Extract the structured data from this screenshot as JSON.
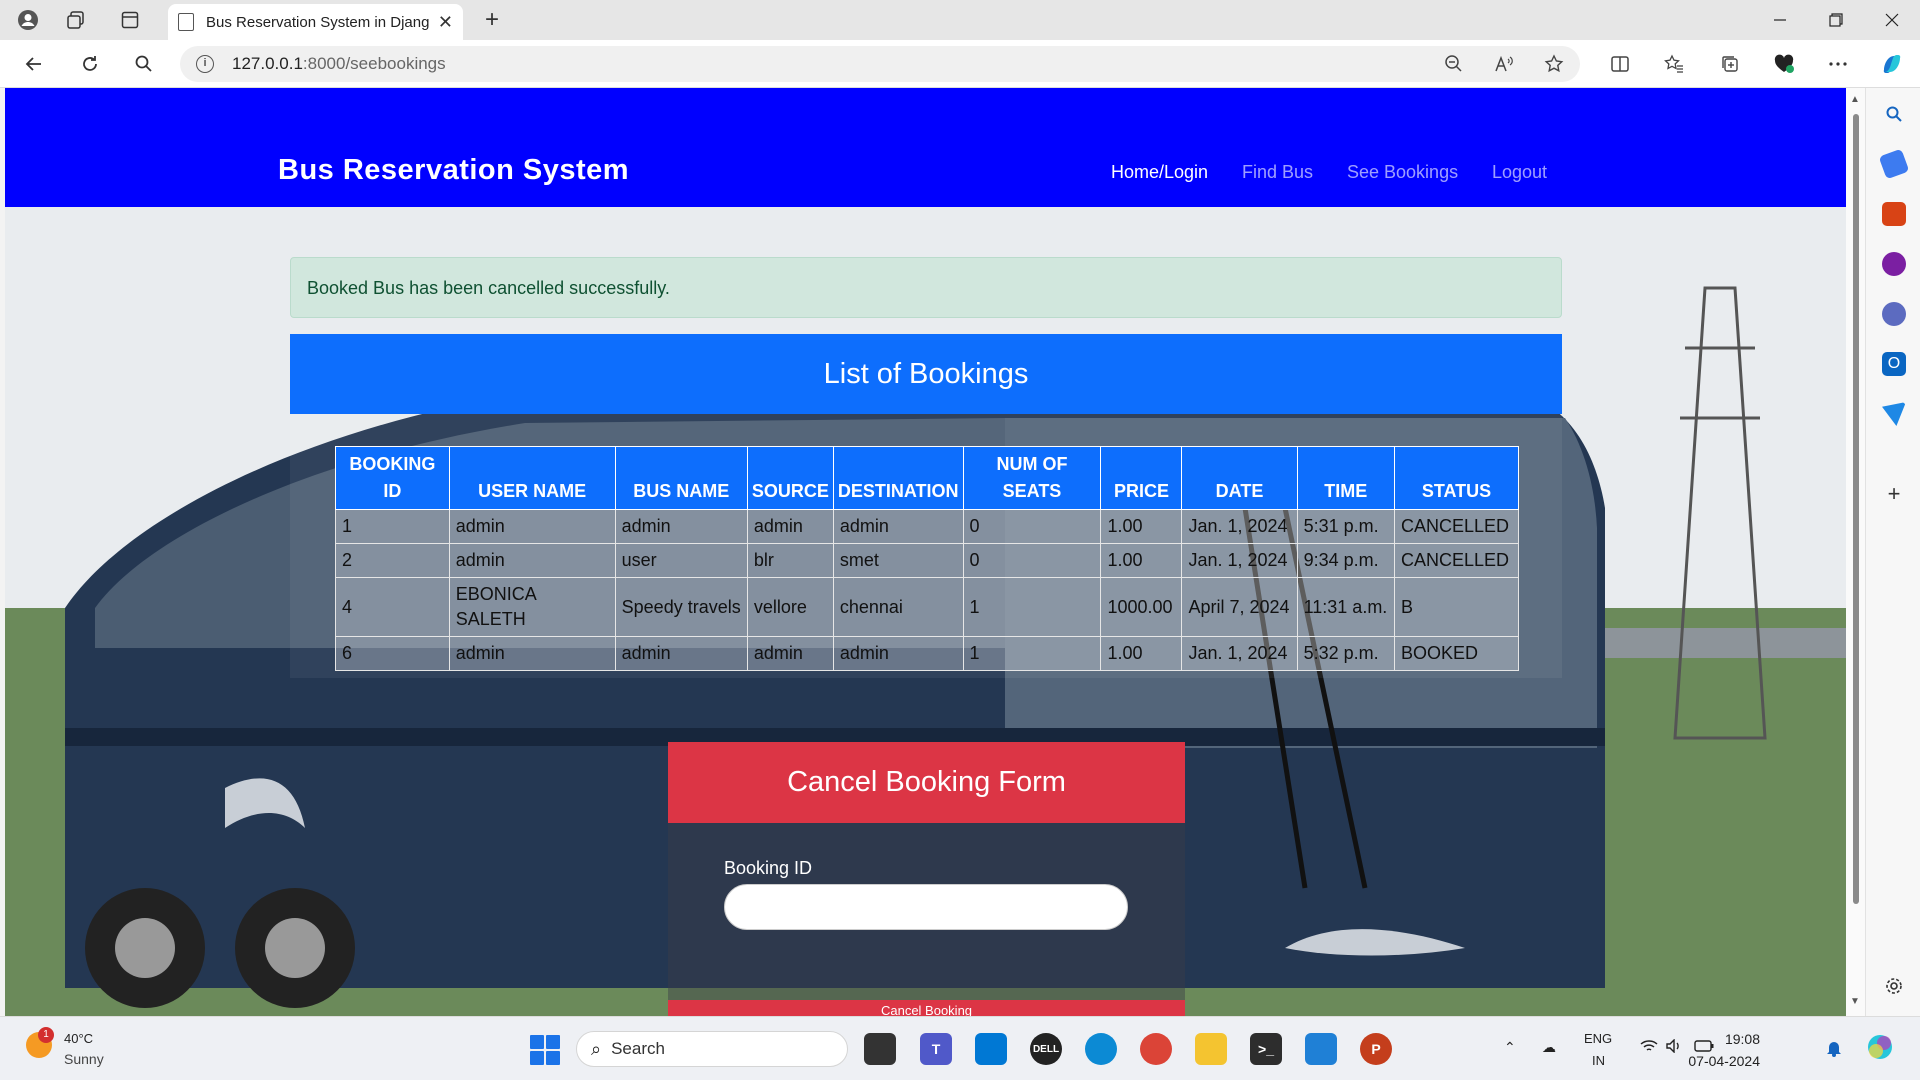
{
  "browser": {
    "tab_title": "Bus Reservation System in Djang",
    "url_host": "127.0.0.1",
    "url_path": ":8000/seebookings",
    "new_tab_glyph": "+",
    "close_glyph": "✕"
  },
  "navbar": {
    "brand": "Bus Reservation System",
    "links": [
      {
        "label": "Home/Login",
        "active": true
      },
      {
        "label": "Find Bus",
        "active": false
      },
      {
        "label": "See Bookings",
        "active": false
      },
      {
        "label": "Logout",
        "active": false
      }
    ],
    "color": "#0000ff"
  },
  "alert": {
    "message": "Booked Bus has been cancelled successfully."
  },
  "bookings": {
    "title": "List of Bookings",
    "headers": [
      "BOOKING ID",
      "USER NAME",
      "BUS NAME",
      "SOURCE",
      "DESTINATION",
      "NUM OF SEATS",
      "PRICE",
      "DATE",
      "TIME",
      "STATUS"
    ],
    "rows": [
      [
        "1",
        "admin",
        "admin",
        "admin",
        "admin",
        "0",
        "1.00",
        "Jan. 1, 2024",
        "5:31 p.m.",
        "CANCELLED"
      ],
      [
        "2",
        "admin",
        "user",
        "blr",
        "smet",
        "0",
        "1.00",
        "Jan. 1, 2024",
        "9:34 p.m.",
        "CANCELLED"
      ],
      [
        "4",
        "EBONICA SALETH",
        "Speedy travels",
        "vellore",
        "chennai",
        "1",
        "1000.00",
        "April 7, 2024",
        "11:31 a.m.",
        "B"
      ],
      [
        "6",
        "admin",
        "admin",
        "admin",
        "admin",
        "1",
        "1.00",
        "Jan. 1, 2024",
        "5:32 p.m.",
        "BOOKED"
      ]
    ],
    "header_color": "#0d6efd"
  },
  "cancel_form": {
    "title": "Cancel Booking Form",
    "field_label": "Booking ID",
    "field_value": "",
    "button_label": "Cancel Booking",
    "color": "#dc3545"
  },
  "taskbar": {
    "weather_temp": "40°C",
    "weather_desc": "Sunny",
    "weather_badge": "1",
    "search_label": "Search",
    "lang_top": "ENG",
    "lang_bottom": "IN",
    "time": "19:08",
    "date": "07-04-2024"
  }
}
